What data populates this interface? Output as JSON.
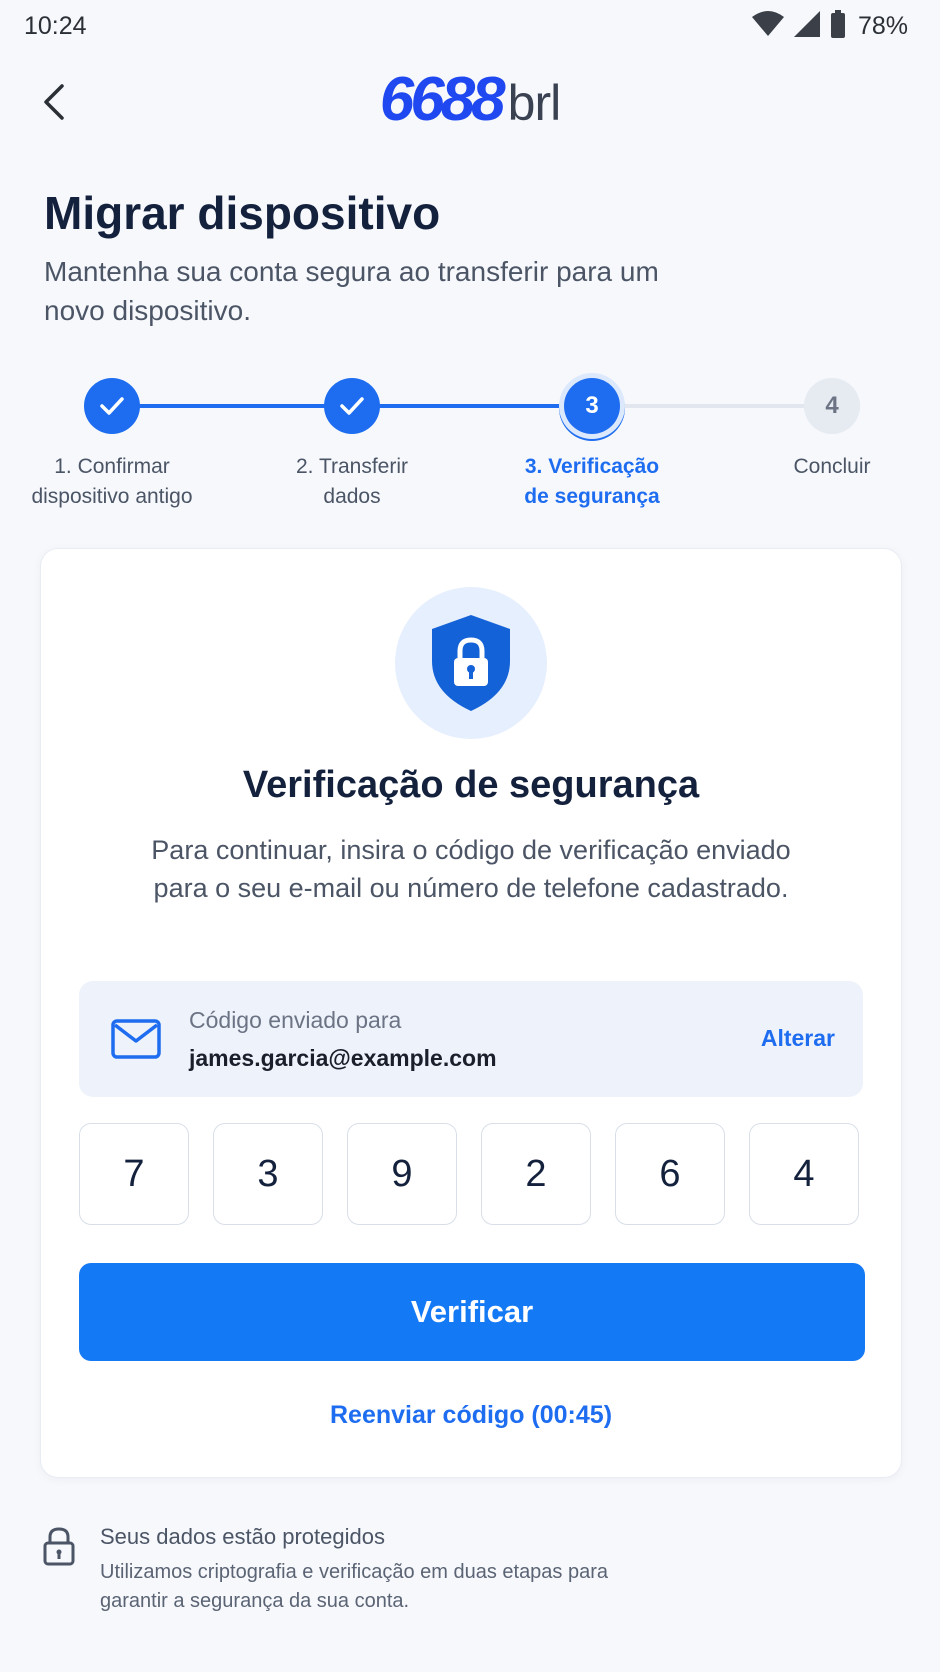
{
  "status_bar": {
    "time": "10:24",
    "battery": "78%"
  },
  "header": {
    "logo_number": "6688",
    "logo_suffix": "brl"
  },
  "page": {
    "title": "Migrar dispositivo",
    "subtitle": "Mantenha sua conta segura ao transferir para um novo dispositivo."
  },
  "stepper": {
    "steps": [
      {
        "marker": "",
        "label": "1. Confirmar dispositivo antigo",
        "state": "done"
      },
      {
        "marker": "",
        "label": "2. Transferir dados",
        "state": "done"
      },
      {
        "marker": "3",
        "label": "3. Verificação de segurança",
        "state": "active"
      },
      {
        "marker": "4",
        "label": "Concluir",
        "state": "todo"
      }
    ]
  },
  "card": {
    "title": "Verificação de segurança",
    "description": "Para continuar, insira o código de verificação enviado para o seu e-mail ou número de telefone cadastrado.",
    "sent_to_label": "Código enviado para",
    "sent_to_email": "james.garcia@example.com",
    "change_label": "Alterar",
    "code_digits": [
      "7",
      "3",
      "9",
      "2",
      "6",
      "4"
    ],
    "verify_label": "Verificar",
    "resend_label": "Reenviar código (00:45)"
  },
  "footer": {
    "title": "Seus dados estão protegidos",
    "text": "Utilizamos criptografia e verificação em duas etapas para garantir a segurança da sua conta."
  },
  "colors": {
    "primary": "#1e6df0",
    "button": "#1479f5",
    "logo": "#1f48f0"
  }
}
